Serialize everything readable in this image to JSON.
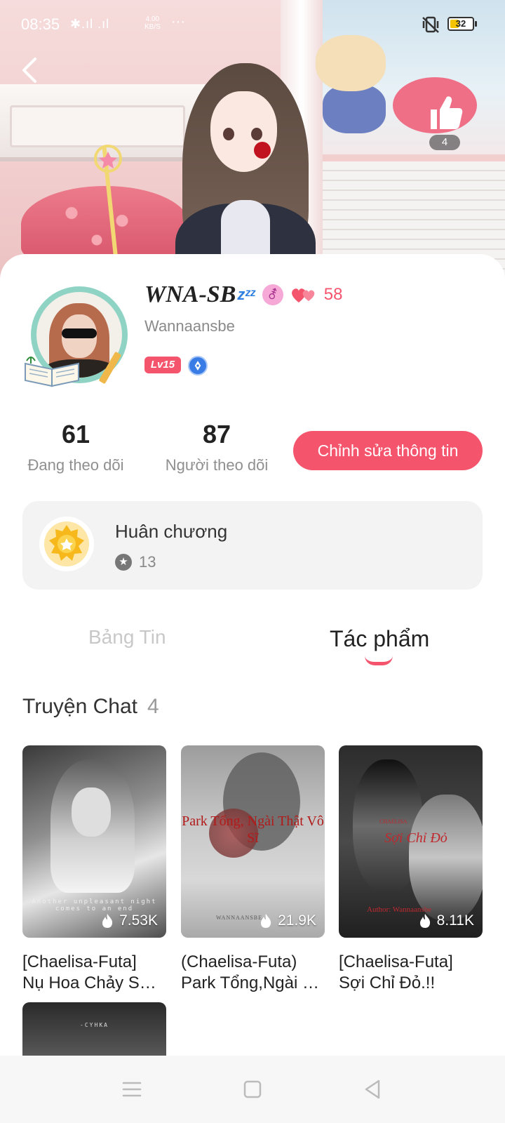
{
  "status_bar": {
    "time": "08:35",
    "signal": "✱.ıl .ıl",
    "speed_value": "4.00",
    "speed_unit": "KB/S",
    "more": "···",
    "battery": "32"
  },
  "header": {
    "like_count": "4"
  },
  "profile": {
    "display_name": "WNA-SB",
    "sleep_emoji": "zᶻᶻ",
    "gender_symbol": "⚦",
    "heart_count": "58",
    "username": "Wannaansbe",
    "level": "Lv15"
  },
  "stats": {
    "following_count": "61",
    "following_label": "Đang theo dõi",
    "followers_count": "87",
    "followers_label": "Người theo dõi",
    "edit_button": "Chỉnh sửa thông tin"
  },
  "medals": {
    "title": "Huân chương",
    "star": "★",
    "count": "13"
  },
  "tabs": {
    "feed": "Bảng Tin",
    "works": "Tác phẩm",
    "active": "works"
  },
  "section": {
    "title": "Truyện Chat",
    "count": "4"
  },
  "books": [
    {
      "title_line1": "[Chaelisa-Futa]",
      "title_line2": "Nụ Hoa Chảy Sữa…",
      "views": "7.53K",
      "cover_caption": "Another unpleasant night comes to an end"
    },
    {
      "title_line1": "(Chaelisa-Futa)",
      "title_line2": "Park Tổng,Ngài …",
      "views": "21.9K",
      "cover_text": "Park Tổng, Ngài Thật Vô Sĩ",
      "cover_signature": "WANNAANSBE"
    },
    {
      "title_line1": "[Chaelisa-Futa]",
      "title_line2": "Sợi Chỉ Đỏ.!!",
      "views": "8.11K",
      "cover_small": "CHAELISA",
      "cover_text": "Sợi Chỉ Đỏ",
      "cover_author": "Author: Wannaansbe"
    },
    {
      "cover_label": "-CYHKA"
    }
  ],
  "colors": {
    "accent": "#f5546d",
    "tab_inactive": "#c8c8c8",
    "medal_card_bg": "#f3f3f3",
    "level_badge": "#f5546d"
  }
}
